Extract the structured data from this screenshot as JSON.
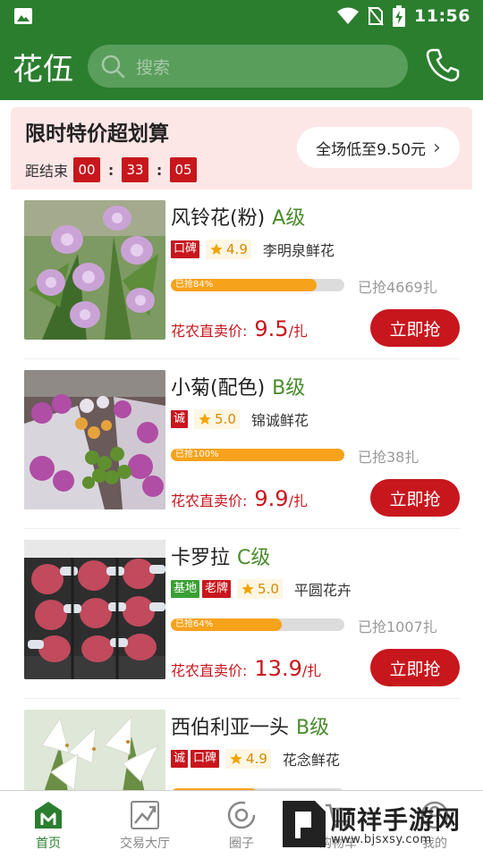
{
  "status_bar": {
    "time": "11:56"
  },
  "app_bar": {
    "brand": "花伍",
    "search_placeholder": "搜索"
  },
  "promo": {
    "title": "限时特价超划算",
    "countdown_label": "距结束",
    "countdown": {
      "hours": "00",
      "minutes": "33",
      "seconds": "05"
    },
    "separator": ":",
    "pill_text": "全场低至9.50元",
    "pill_chevron": "›"
  },
  "products": [
    {
      "name": "风铃花(粉)",
      "grade": "A级",
      "tags": [
        {
          "text": "口碑",
          "color": "red"
        }
      ],
      "rating": "4.9",
      "shop": "李明泉鲜花",
      "progress_text": "已抢84%",
      "progress": 0.84,
      "sold": "已抢4669扎",
      "price_label": "花农直卖价:",
      "price": "9.5",
      "unit": "/扎",
      "buy_label": "立即抢",
      "photo": "bellflower"
    },
    {
      "name": "小菊(配色)",
      "grade": "B级",
      "tags": [
        {
          "text": "诚",
          "color": "red"
        }
      ],
      "rating": "5.0",
      "shop": "锦诚鲜花",
      "progress_text": "已抢100%",
      "progress": 1.0,
      "sold": "已抢38扎",
      "price_label": "花农直卖价:",
      "price": "9.9",
      "unit": "/扎",
      "buy_label": "立即抢",
      "photo": "chrysanthemum"
    },
    {
      "name": "卡罗拉",
      "grade": "C级",
      "tags": [
        {
          "text": "基地",
          "color": "green"
        },
        {
          "text": "老牌",
          "color": "red"
        }
      ],
      "rating": "5.0",
      "shop": "平圆花卉",
      "progress_text": "已抢64%",
      "progress": 0.64,
      "sold": "已抢1007扎",
      "price_label": "花农直卖价:",
      "price": "13.9",
      "unit": "/扎",
      "buy_label": "立即抢",
      "photo": "roses"
    },
    {
      "name": "西伯利亚一头",
      "grade": "B级",
      "tags": [
        {
          "text": "诚",
          "color": "red"
        },
        {
          "text": "口碑",
          "color": "red"
        }
      ],
      "rating": "4.9",
      "shop": "花念鲜花",
      "progress_text": "",
      "progress": 0.5,
      "sold": "",
      "price_label": "",
      "price": "",
      "unit": "",
      "buy_label": "",
      "photo": "lily"
    }
  ],
  "bottom_nav": [
    {
      "label": "首页",
      "icon": "home-icon",
      "active": true
    },
    {
      "label": "交易大厅",
      "icon": "trend-chart-icon",
      "active": false
    },
    {
      "label": "圈子",
      "icon": "circle-icon",
      "active": false
    },
    {
      "label": "购物车",
      "icon": "cart-icon",
      "active": false
    },
    {
      "label": "我的",
      "icon": "user-icon",
      "active": false
    }
  ],
  "watermark": {
    "title": "顺祥手游网",
    "url": "www.bjsxsy.com"
  },
  "colors": {
    "brand_green": "#2a7e2e",
    "accent_red": "#c8161d",
    "progress_orange": "#f7a21b",
    "promo_bg": "#fde6e6"
  }
}
